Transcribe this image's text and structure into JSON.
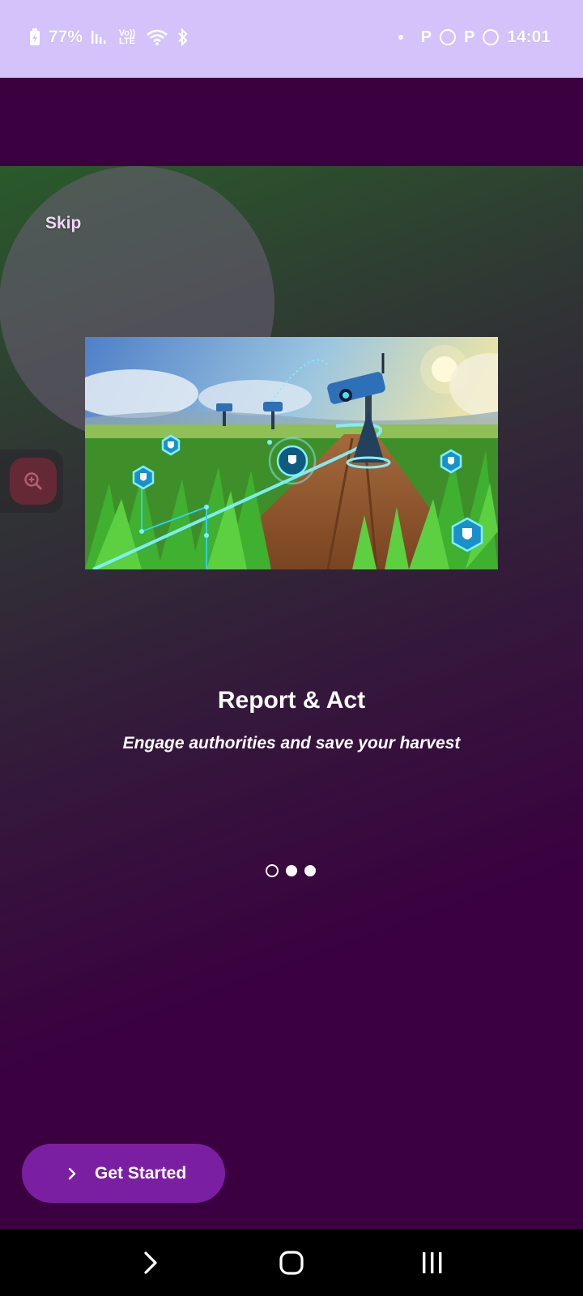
{
  "status_bar": {
    "battery": "77%",
    "network_label": "Vo)) LTE",
    "time": "14:01",
    "icons": [
      "battery-charging-icon",
      "signal-icon",
      "volte-icon",
      "wifi-icon",
      "bluetooth-icon",
      "notification-dot-icon",
      "parking-icon",
      "whatsapp-icon",
      "parking-icon",
      "whatsapp-icon"
    ]
  },
  "onboarding": {
    "skip_label": "Skip",
    "title": "Report & Act",
    "subtitle": "Engage authorities and save your harvest",
    "page_count": 3,
    "active_page": 1,
    "cta_label": "Get Started",
    "hero_image": "smart-farm-surveillance-illustration"
  },
  "nav_bar": {
    "buttons": [
      "back-icon",
      "home-icon",
      "recents-icon"
    ]
  },
  "colors": {
    "status_bar_bg": "#d4c2fb",
    "app_bg": "#3a0040",
    "cta_bg": "#7b1fa2",
    "accent_cyan": "#2ad4ff"
  }
}
